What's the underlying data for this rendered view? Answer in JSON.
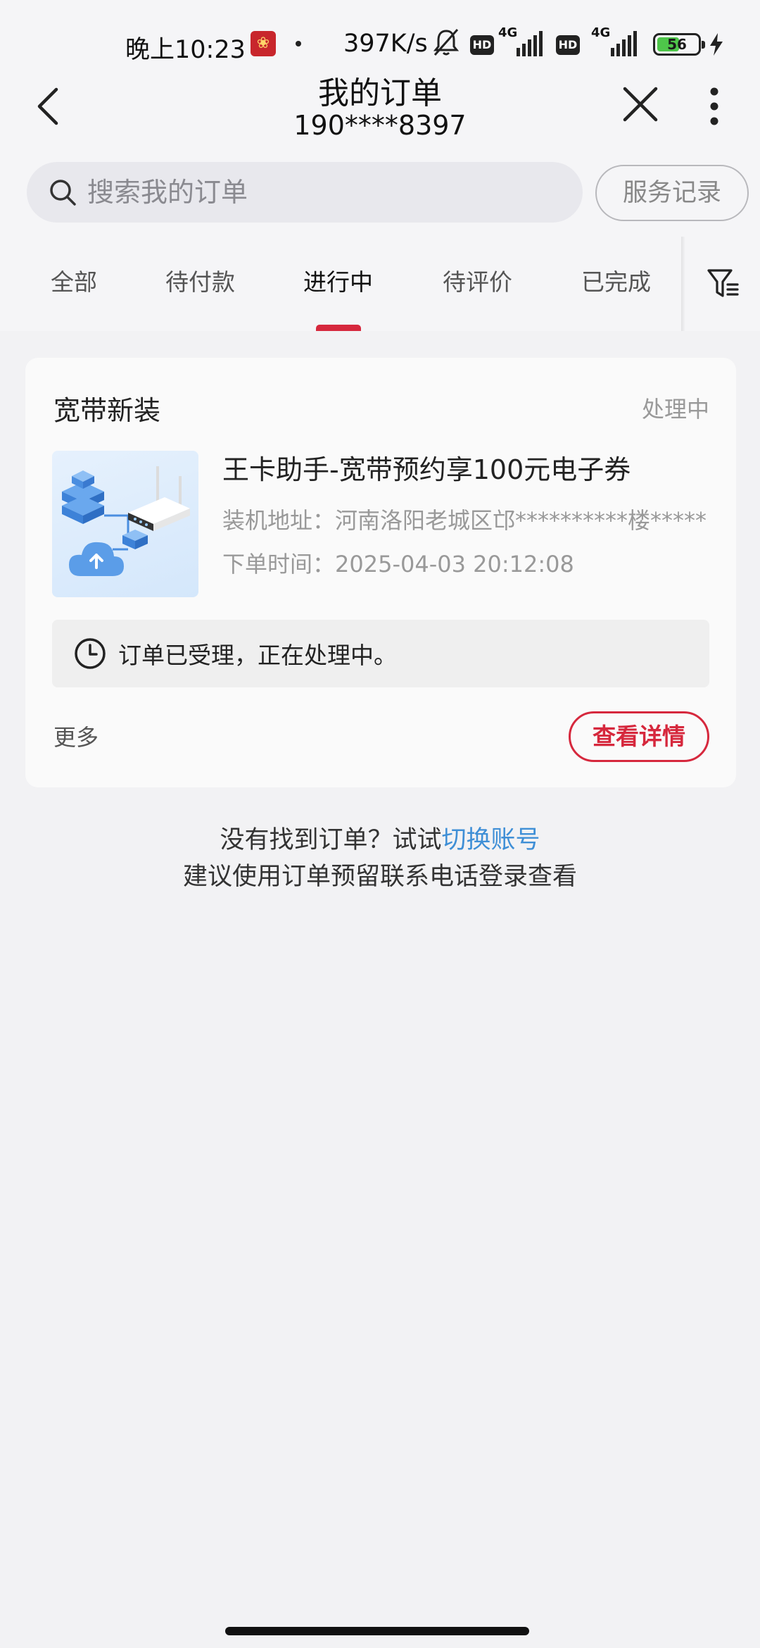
{
  "status_bar": {
    "time": "晚上10:23",
    "net_speed": "397K/s",
    "sim1_hd": "HD",
    "sim1_network": "4G",
    "sim2_hd": "HD",
    "sim2_network": "4G",
    "battery_level": 56,
    "battery_text": "56",
    "icons": [
      "app-notification-icon",
      "silent-bell-icon",
      "signal-icon",
      "battery-icon",
      "charging-icon"
    ]
  },
  "header": {
    "title": "我的订单",
    "subtitle": "190****8397",
    "icons": [
      "back-icon",
      "close-icon",
      "more-vertical-icon"
    ]
  },
  "search": {
    "placeholder": "搜索我的订单",
    "service_record_label": "服务记录"
  },
  "tabs": [
    {
      "label": "全部",
      "active": false
    },
    {
      "label": "待付款",
      "active": false
    },
    {
      "label": "进行中",
      "active": true
    },
    {
      "label": "待评价",
      "active": false
    },
    {
      "label": "已完成",
      "active": false
    }
  ],
  "orders": [
    {
      "category": "宽带新装",
      "status": "处理中",
      "product_name": "王卡助手-宽带预约享100元电子券",
      "address": "装机地址：河南洛阳老城区邙**********楼*****",
      "order_time": "下单时间：2025-04-03 20:12:08",
      "notice": "订单已受理，正在处理中。",
      "more_label": "更多",
      "detail_label": "查看详情"
    }
  ],
  "footer_hint": {
    "line1_prefix": "没有找到订单？试试",
    "line1_link": "切换账号",
    "line2": "建议使用订单预留联系电话登录查看"
  },
  "colors": {
    "accent": "#d6283d",
    "link": "#3f8fd6",
    "background": "#f2f2f4"
  }
}
